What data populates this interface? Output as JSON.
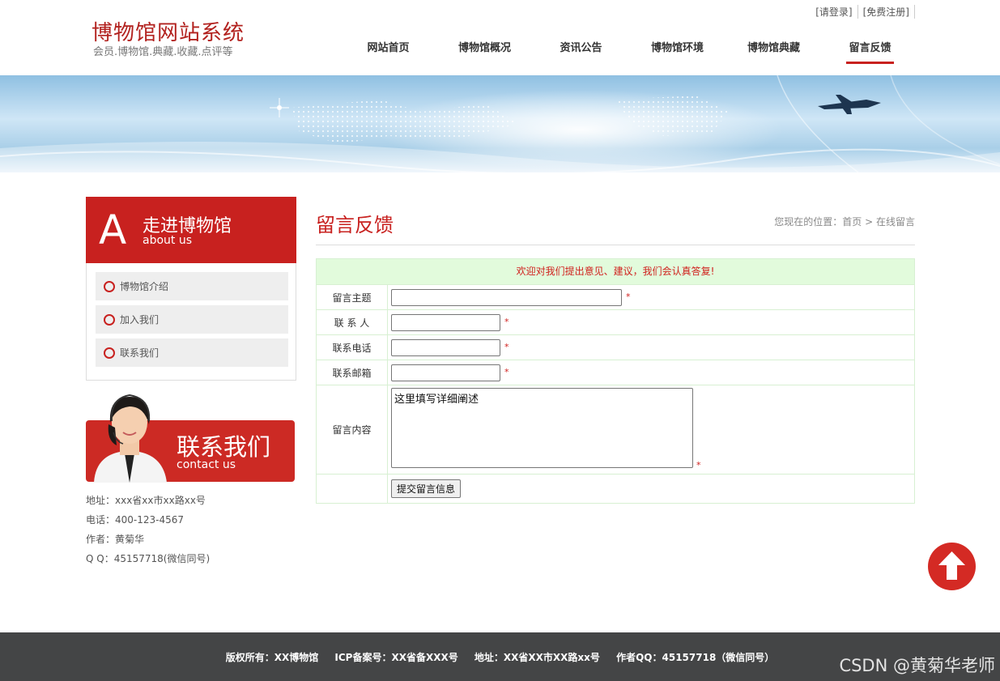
{
  "header": {
    "site_title": "博物馆网站系统",
    "site_subtitle": "会员.博物馆.典藏.收藏.点评等",
    "login_link": "[请登录]",
    "register_link": "[免费注册]",
    "nav": [
      {
        "label": "网站首页"
      },
      {
        "label": "博物馆概况"
      },
      {
        "label": "资讯公告"
      },
      {
        "label": "博物馆环境"
      },
      {
        "label": "博物馆典藏"
      },
      {
        "label": "留言反馈",
        "active": true
      }
    ]
  },
  "sidebar": {
    "letter": "A",
    "title": "走进博物馆",
    "subtitle": "about us",
    "items": [
      {
        "label": "博物馆介绍"
      },
      {
        "label": "加入我们"
      },
      {
        "label": "联系我们"
      }
    ],
    "contact_title": "联系我们",
    "contact_subtitle": "contact us",
    "info": {
      "address": "地址：xxx省xx市xx路xx号",
      "phone": "电话：400-123-4567",
      "author": "作者：黄菊华",
      "qq": "Q Q：45157718(微信同号)"
    }
  },
  "main": {
    "title": "留言反馈",
    "breadcrumb": {
      "prefix": "您现在的位置：",
      "home": "首页",
      "separator": ">",
      "current": "在线留言"
    },
    "form": {
      "welcome": "欢迎对我们提出意见、建议，我们会认真答复!",
      "subject_label": "留言主题",
      "subject_value": "",
      "contact_label": "联 系 人",
      "contact_value": "",
      "phone_label": "联系电话",
      "phone_value": "",
      "email_label": "联系邮箱",
      "email_value": "",
      "content_label": "留言内容",
      "content_value": "这里填写详细阐述",
      "required_mark": "*",
      "submit_label": "提交留言信息"
    }
  },
  "footer": {
    "copyright": "版权所有：XX博物馆",
    "icp": "ICP备案号：XX省备XXX号",
    "address": "地址：XX省XX市XX路xx号",
    "author_qq": "作者QQ：45157718（微信同号）"
  },
  "watermark": "CSDN @黄菊华老师",
  "colors": {
    "accent_red": "#c8211f",
    "footer_bg": "#444546",
    "welcome_bg": "#e2fbdc"
  }
}
